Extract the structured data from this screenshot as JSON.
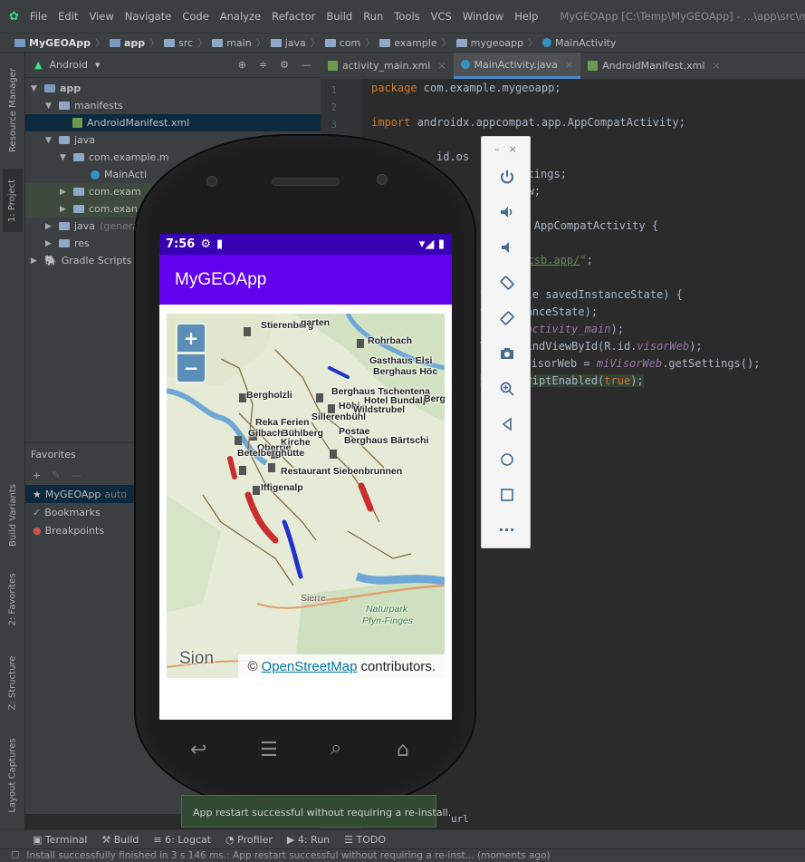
{
  "menu": {
    "items": [
      "File",
      "Edit",
      "View",
      "Navigate",
      "Code",
      "Analyze",
      "Refactor",
      "Build",
      "Run",
      "Tools",
      "VCS",
      "Window",
      "Help"
    ],
    "window_title": "MyGEOApp [C:\\Temp\\MyGEOApp] - ...\\app\\src\\main\\java\\"
  },
  "breadcrumb": [
    "MyGEOApp",
    "app",
    "src",
    "main",
    "java",
    "com",
    "example",
    "mygeoapp",
    "MainActivity"
  ],
  "side_tabs": {
    "resource_manager": "Resource Manager",
    "project": "1: Project",
    "build_variants": "Build Variants",
    "favorites": "2: Favorites",
    "structure": "Z: Structure",
    "layout_captures": "Layout Captures"
  },
  "project": {
    "view_selector": "Android",
    "tree": [
      {
        "label": "app",
        "level": 0,
        "bold": true
      },
      {
        "label": "manifests",
        "level": 1
      },
      {
        "label": "AndroidManifest.xml",
        "level": 2,
        "selected": true
      },
      {
        "label": "java",
        "level": 1
      },
      {
        "label": "com.example.m",
        "level": 2
      },
      {
        "label": "MainActi",
        "level": 3
      },
      {
        "label": "com.exam",
        "level": 2
      },
      {
        "label": "com.exan",
        "level": 2
      },
      {
        "label": "java",
        "suffix": "(generat",
        "level": 1
      },
      {
        "label": "res",
        "level": 1
      },
      {
        "label": "Gradle Scripts",
        "level": 0
      }
    ]
  },
  "favorites": {
    "title": "Favorites",
    "items": [
      {
        "label": "MyGEOApp",
        "suffix": "auto"
      },
      {
        "label": "Bookmarks"
      },
      {
        "label": "Breakpoints"
      }
    ]
  },
  "editor": {
    "tabs": [
      {
        "label": "activity_main.xml",
        "active": false
      },
      {
        "label": "MainActivity.java",
        "active": true
      },
      {
        "label": "AndroidManifest.xml",
        "active": false
      }
    ],
    "line_numbers": [
      "1",
      "2",
      "3"
    ],
    "lines": [
      {
        "text": "package com.example.mygeoapp;"
      },
      {
        "text": ""
      },
      {
        "text": "import androidx.appcompat.app.AppCompatActivity;"
      },
      {
        "text": ""
      },
      {
        "text": "id.os"
      },
      {
        "text": "oi       .WebSettings;"
      },
      {
        "text": "oi       .WebView;"
      },
      {
        "text": ""
      },
      {
        "text": "n        extends AppCompatActivity {"
      },
      {
        "text": ""
      },
      {
        "text": "/8kwot.csb.app/\";"
      },
      {
        "text": ""
      },
      {
        "text": "te(Bundle savedInstanceState) {"
      },
      {
        "text": "vedInstanceState);"
      },
      {
        "text": "layout.activity_main);"
      },
      {
        "text": "View) findViewById(R.id.visorWeb);"
      },
      {
        "text": " adjustVisorWeb = miVisorWeb.getSettings();"
      },
      {
        "text": "tJavaScriptEnabled(true);"
      },
      {
        "text": "l(url);"
      }
    ]
  },
  "emulator_toolbar": [
    "power-icon",
    "volume-up-icon",
    "volume-down-icon",
    "rotate-left-icon",
    "rotate-right-icon",
    "camera-icon",
    "zoom-icon",
    "back-icon",
    "home-icon",
    "overview-icon",
    "more-icon"
  ],
  "device": {
    "time": "7:56",
    "app_title": "MyGEOApp",
    "map": {
      "labels": [
        "Stierenberg",
        "garten",
        "Rohrbach",
        "Gasthaus Elsi",
        "Berghaus Höc",
        "Bergholzli",
        "Berghaus Tschentena",
        "Hotel Bundalp",
        "Berg",
        "Höhi",
        "Wildstrubel",
        "Sillerenbühl",
        "Reka Ferien",
        "Bühlberg",
        "Kirche",
        "Gilbach",
        "Postae",
        "Oberrie",
        "Berghaus Bärtschi",
        "Betelberghütte",
        "Restaurant Siebenbrunnen",
        "Iffigenalp",
        "Sierre",
        "Naturpark",
        "Pfyn-Finges",
        "Sion"
      ],
      "attribution_prefix": "©",
      "attribution_link": "OpenStreetMap",
      "attribution_suffix": "contributors."
    }
  },
  "toast": "App restart successful without requiring a re-install.",
  "editor_bottom_word": "url",
  "bottom_tools": [
    "Terminal",
    "Build",
    "6: Logcat",
    "Profiler",
    "4: Run",
    "TODO"
  ],
  "status_text": "Install successfully finished in 3 s 146 ms.: App restart successful without requiring a re-inst... (moments ago)"
}
